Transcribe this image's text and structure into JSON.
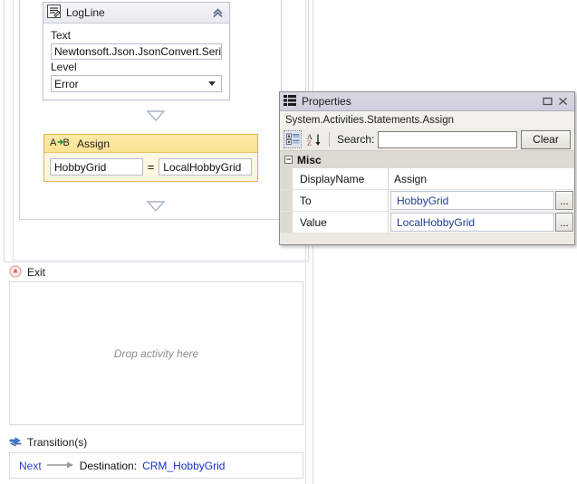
{
  "designer": {
    "logline": {
      "icon": "logline-icon",
      "title": "LogLine",
      "collapse_icon": "chevron-double-up-icon",
      "text_label": "Text",
      "text_value": "Newtonsoft.Json.JsonConvert.Serialize",
      "level_label": "Level",
      "level_value": "Error"
    },
    "assign": {
      "icon": "assign-ab-icon",
      "title": "Assign",
      "to_value": "HobbyGrid",
      "operator": "=",
      "value_value": "LocalHobbyGrid"
    },
    "exit": {
      "icon": "exit-icon",
      "label": "Exit",
      "dropzone_text": "Drop activity here"
    },
    "transitions": {
      "icon": "transitions-icon",
      "label": "Transition(s)",
      "next_label": "Next",
      "arrow_icon": "arrow-right-icon",
      "destination_label": "Destination:",
      "destination_value": "CRM_HobbyGrid"
    }
  },
  "properties": {
    "window_icon": "properties-grid-icon",
    "title": "Properties",
    "maximize_icon": "maximize-icon",
    "close_icon": "close-icon",
    "type_name": "System.Activities.Statements.Assign",
    "toolbar": {
      "categorized_icon": "categorized-view-icon",
      "alphabetical_icon": "alphabetical-sort-icon",
      "search_label": "Search:",
      "search_value": "",
      "search_placeholder": "",
      "clear_label": "Clear"
    },
    "category": {
      "expander": "−",
      "name": "Misc"
    },
    "rows": [
      {
        "name": "DisplayName",
        "value": "Assign",
        "editable": false,
        "has_ellipsis": false
      },
      {
        "name": "To",
        "value": "HobbyGrid",
        "editable": true,
        "has_ellipsis": true,
        "ellipsis_label": "..."
      },
      {
        "name": "Value",
        "value": "LocalHobbyGrid",
        "editable": true,
        "has_ellipsis": true,
        "ellipsis_label": "..."
      }
    ]
  },
  "colors": {
    "assign_header": "#fbe293",
    "assign_border": "#e0b54a",
    "link": "#2b3fd0",
    "grid_value": "#1c3f94",
    "titlebar": "#cfcede"
  }
}
